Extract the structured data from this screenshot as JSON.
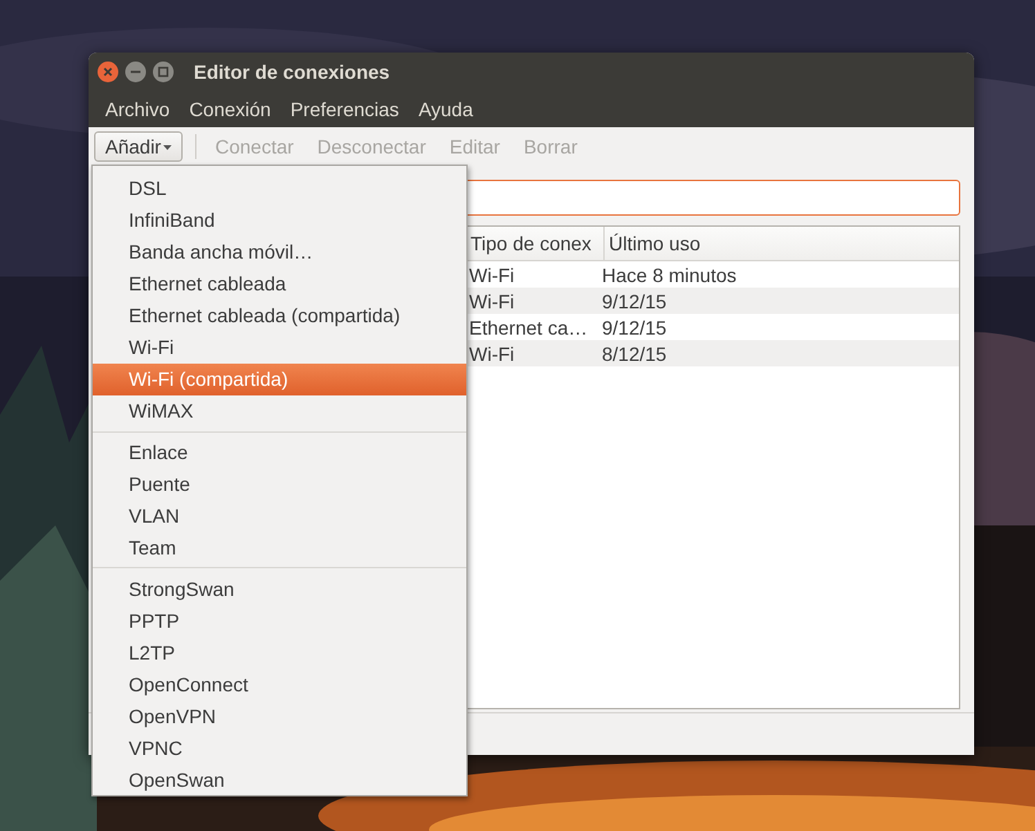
{
  "window": {
    "title": "Editor de conexiones"
  },
  "menubar": [
    {
      "label": "Archivo"
    },
    {
      "label": "Conexión"
    },
    {
      "label": "Preferencias"
    },
    {
      "label": "Ayuda"
    }
  ],
  "toolbar": [
    {
      "label": "Añadir",
      "kind": "dropdown",
      "disabled": false
    },
    {
      "label": "Conectar",
      "kind": "button",
      "disabled": true
    },
    {
      "label": "Desconectar",
      "kind": "button",
      "disabled": true
    },
    {
      "label": "Editar",
      "kind": "button",
      "disabled": true
    },
    {
      "label": "Borrar",
      "kind": "button",
      "disabled": true
    }
  ],
  "search": {
    "focused": true
  },
  "table": {
    "columns": [
      "Tipo de conex",
      "Último uso"
    ],
    "rows": [
      [
        "Wi-Fi",
        "Hace 8 minutos"
      ],
      [
        "Wi-Fi",
        "9/12/15"
      ],
      [
        "Ethernet ca…",
        "9/12/15"
      ],
      [
        "Wi-Fi",
        "8/12/15"
      ]
    ]
  },
  "add_menu": {
    "groups": [
      [
        {
          "label": "DSL",
          "selected": false
        },
        {
          "label": "InfiniBand",
          "selected": false
        },
        {
          "label": "Banda ancha móvil…",
          "selected": false
        },
        {
          "label": "Ethernet cableada",
          "selected": false
        },
        {
          "label": "Ethernet cableada (compartida)",
          "selected": false
        },
        {
          "label": "Wi-Fi",
          "selected": false
        },
        {
          "label": "Wi-Fi (compartida)",
          "selected": true
        },
        {
          "label": "WiMAX",
          "selected": false
        }
      ],
      [
        {
          "label": "Enlace",
          "selected": false
        },
        {
          "label": "Puente",
          "selected": false
        },
        {
          "label": "VLAN",
          "selected": false
        },
        {
          "label": "Team",
          "selected": false
        }
      ],
      [
        {
          "label": "StrongSwan",
          "selected": false
        },
        {
          "label": "PPTP",
          "selected": false
        },
        {
          "label": "L2TP",
          "selected": false
        },
        {
          "label": "OpenConnect",
          "selected": false
        },
        {
          "label": "OpenVPN",
          "selected": false
        },
        {
          "label": "VPNC",
          "selected": false
        },
        {
          "label": "OpenSwan",
          "selected": false
        }
      ]
    ]
  }
}
